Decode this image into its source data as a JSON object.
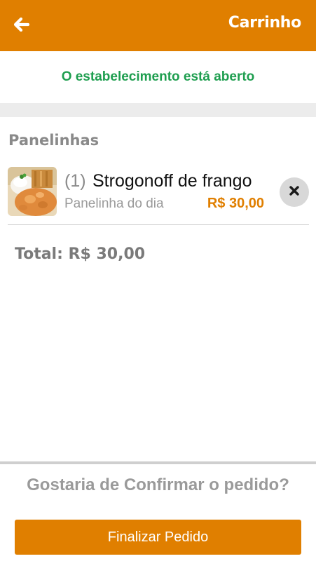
{
  "header": {
    "title": "Carrinho",
    "back_icon": "arrow-left-icon"
  },
  "status": {
    "text": "O estabelecimento está aberto",
    "color": "#1e9e4f"
  },
  "cart": {
    "category": "Panelinhas",
    "items": [
      {
        "quantity": "(1)",
        "name": "Strogonoff de frango",
        "description": "Panelinha do dia",
        "price": "R$ 30,00",
        "thumbnail_icon": "food-photo",
        "remove_icon": "close-icon"
      }
    ],
    "total": "Total: R$ 30,00"
  },
  "footer": {
    "question": "Gostaria de Confirmar o pedido?",
    "finalize_label": "Finalizar Pedido"
  },
  "colors": {
    "accent": "#e07f00",
    "status_open": "#1e9e4f",
    "muted_text": "#9a9a9a",
    "band": "#ececec"
  }
}
